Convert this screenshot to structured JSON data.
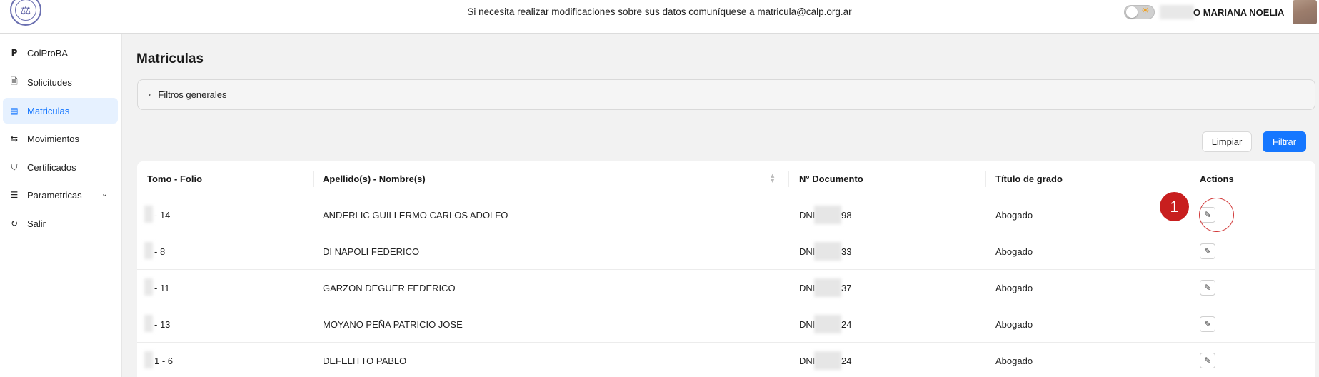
{
  "header": {
    "notice": "Si necesita realizar modificaciones sobre sus datos comuníquese a matricula@calp.org.ar",
    "user_name": "O MARIANA NOELIA",
    "logo_symbol": "⚖",
    "toggle_icon": "sun-icon"
  },
  "sidebar": {
    "items": [
      {
        "label": "ColProBA",
        "icon": "P"
      },
      {
        "label": "Solicitudes",
        "icon": "🗎"
      },
      {
        "label": "Matriculas",
        "icon": "▤"
      },
      {
        "label": "Movimientos",
        "icon": "⇆"
      },
      {
        "label": "Certificados",
        "icon": "⛉"
      },
      {
        "label": "Parametricas",
        "icon": "☰",
        "chevron": "⌄"
      },
      {
        "label": "Salir",
        "icon": "↻"
      }
    ],
    "active_index": 2
  },
  "main": {
    "title": "Matriculas",
    "filters_label": "Filtros generales",
    "filters_arrow": "›",
    "clear_label": "Limpiar",
    "filter_label": "Filtrar"
  },
  "table": {
    "columns": [
      "Tomo - Folio",
      "Apellido(s) - Nombre(s)",
      "N° Documento",
      "Título de grado",
      "Actions"
    ],
    "sort_icon": "▲▼",
    "edit_icon": "✎",
    "rows": [
      {
        "tomo": "- 14",
        "nombre": "ANDERLIC GUILLERMO CARLOS ADOLFO",
        "doc_prefix": "DNI",
        "doc_suffix": "98",
        "titulo": "Abogado"
      },
      {
        "tomo": "- 8",
        "nombre": "DI NAPOLI FEDERICO",
        "doc_prefix": "DNI",
        "doc_suffix": "33",
        "titulo": "Abogado"
      },
      {
        "tomo": "- 11",
        "nombre": "GARZON DEGUER FEDERICO",
        "doc_prefix": "DNI",
        "doc_suffix": "37",
        "titulo": "Abogado"
      },
      {
        "tomo": "- 13",
        "nombre": "MOYANO PEÑA PATRICIO JOSE",
        "doc_prefix": "DNI",
        "doc_suffix": "24",
        "titulo": "Abogado"
      },
      {
        "tomo": "1 - 6",
        "nombre": "DEFELITTO PABLO",
        "doc_prefix": "DNI",
        "doc_suffix": "24",
        "titulo": "Abogado"
      }
    ]
  },
  "annotation": {
    "marker": "1",
    "color": "#c81e1e"
  },
  "colors": {
    "accent": "#1677ff",
    "active_bg": "#e6f1ff"
  }
}
